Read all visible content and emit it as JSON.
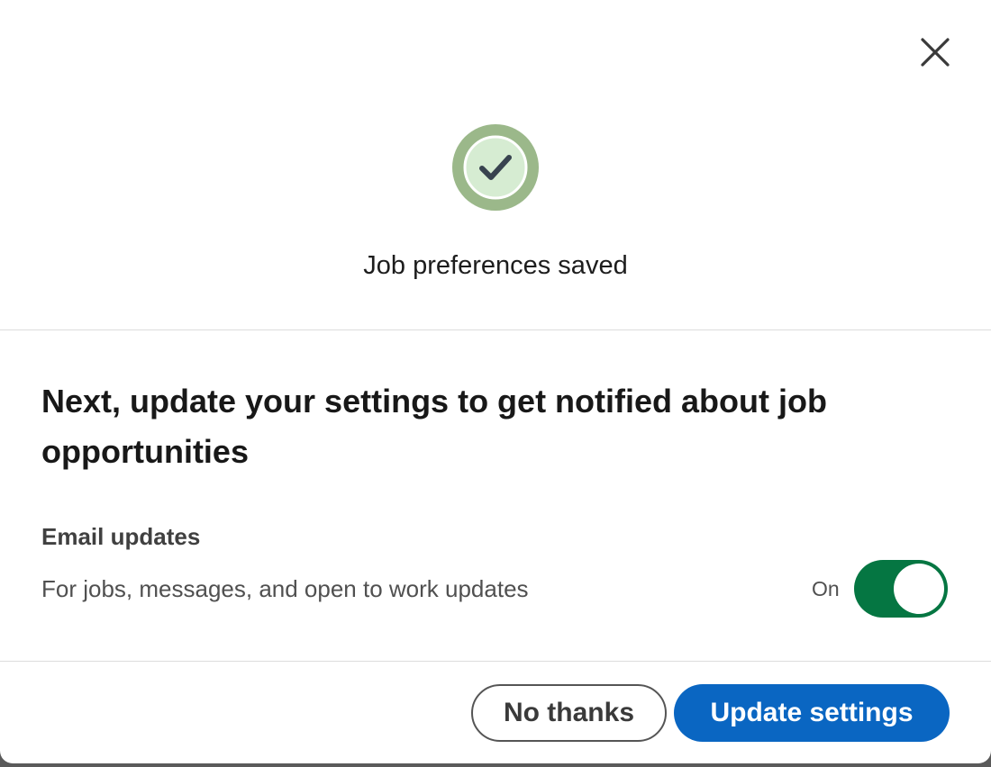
{
  "dialog": {
    "close_icon": "close-icon",
    "success_icon": "checkmark-icon",
    "saved_message": "Job preferences saved",
    "heading": "Next, update your settings to get notified about job opportunities",
    "email": {
      "label": "Email updates",
      "description": "For jobs, messages, and open to work updates",
      "toggle_state": "On",
      "toggle_on": true
    },
    "buttons": {
      "secondary_label": "No thanks",
      "primary_label": "Update settings"
    }
  },
  "colors": {
    "primary": "#0a66c2",
    "toggle_on": "#057642",
    "success_ring": "#9bb88a",
    "success_inner": "#d6ecd2",
    "check": "#38434f"
  }
}
